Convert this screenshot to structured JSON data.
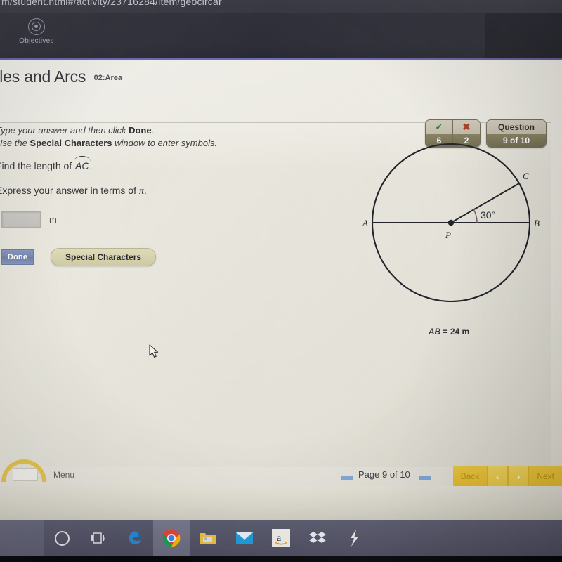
{
  "browser": {
    "url_text": "m/student.html#/activity/23716284/item/geocircar",
    "objectives_label": "Objectives",
    "objectives_icon": "target-icon"
  },
  "lesson": {
    "title": "cles and Arcs",
    "subtitle": "02:Area"
  },
  "instructions": {
    "line1_a": "Type your answer and then click ",
    "line1_bold": "Done",
    "line1_b": ".",
    "line2_a": "Use the ",
    "line2_bold": "Special Characters",
    "line2_b": " window to enter symbols."
  },
  "question": {
    "prompt_prefix": "Find the length of ",
    "arc_label": "AC",
    "prompt_suffix": ".",
    "express_text": "Express your answer in terms of ",
    "express_symbol": "π",
    "express_suffix": "."
  },
  "answer": {
    "value": "",
    "placeholder": "",
    "unit": "m"
  },
  "buttons": {
    "done": "Done",
    "special_characters": "Special Characters"
  },
  "score": {
    "correct_icon": "check-icon",
    "correct_glyph": "✓",
    "correct_count": "6",
    "wrong_icon": "cross-icon",
    "wrong_glyph": "✖",
    "wrong_count": "2",
    "question_label": "Question",
    "question_value": "9 of 10",
    "correct_color": "#1f7a28",
    "wrong_color": "#b3331f",
    "panel_dark": "#6f6a4e",
    "panel_light": "#c6c0b0"
  },
  "figure": {
    "center_label": "P",
    "point_a": "A",
    "point_b": "B",
    "point_c": "C",
    "angle_label": "30°",
    "caption_ab": "AB",
    "caption_rest": " = 24 m",
    "stroke_color": "#1d1d26"
  },
  "bottom": {
    "menu_label": "Menu",
    "page_text": "Page  9 of 10",
    "back_label": "Back",
    "prev_glyph": "‹",
    "next_glyph": "›",
    "next_label": "Next",
    "accent_color": "#eec93c"
  },
  "taskbar": {
    "items": [
      {
        "name": "cortana-icon",
        "label": ""
      },
      {
        "name": "task-view-icon",
        "label": ""
      },
      {
        "name": "edge-browser-icon",
        "label": ""
      },
      {
        "name": "chrome-browser-icon",
        "label": ""
      },
      {
        "name": "file-explorer-icon",
        "label": ""
      },
      {
        "name": "mail-icon",
        "label": ""
      },
      {
        "name": "amazon-icon",
        "label": "a"
      },
      {
        "name": "dropbox-icon",
        "label": ""
      },
      {
        "name": "lightning-app-icon",
        "label": ""
      }
    ]
  },
  "chart_data": {
    "type": "diagram",
    "title": "Circle P with diameter AB and radius PC",
    "diameter_m": 24,
    "radius_m": 12,
    "central_angle_deg": 30,
    "points": [
      "A",
      "B",
      "C",
      "P"
    ],
    "caption": "AB = 24 m"
  }
}
